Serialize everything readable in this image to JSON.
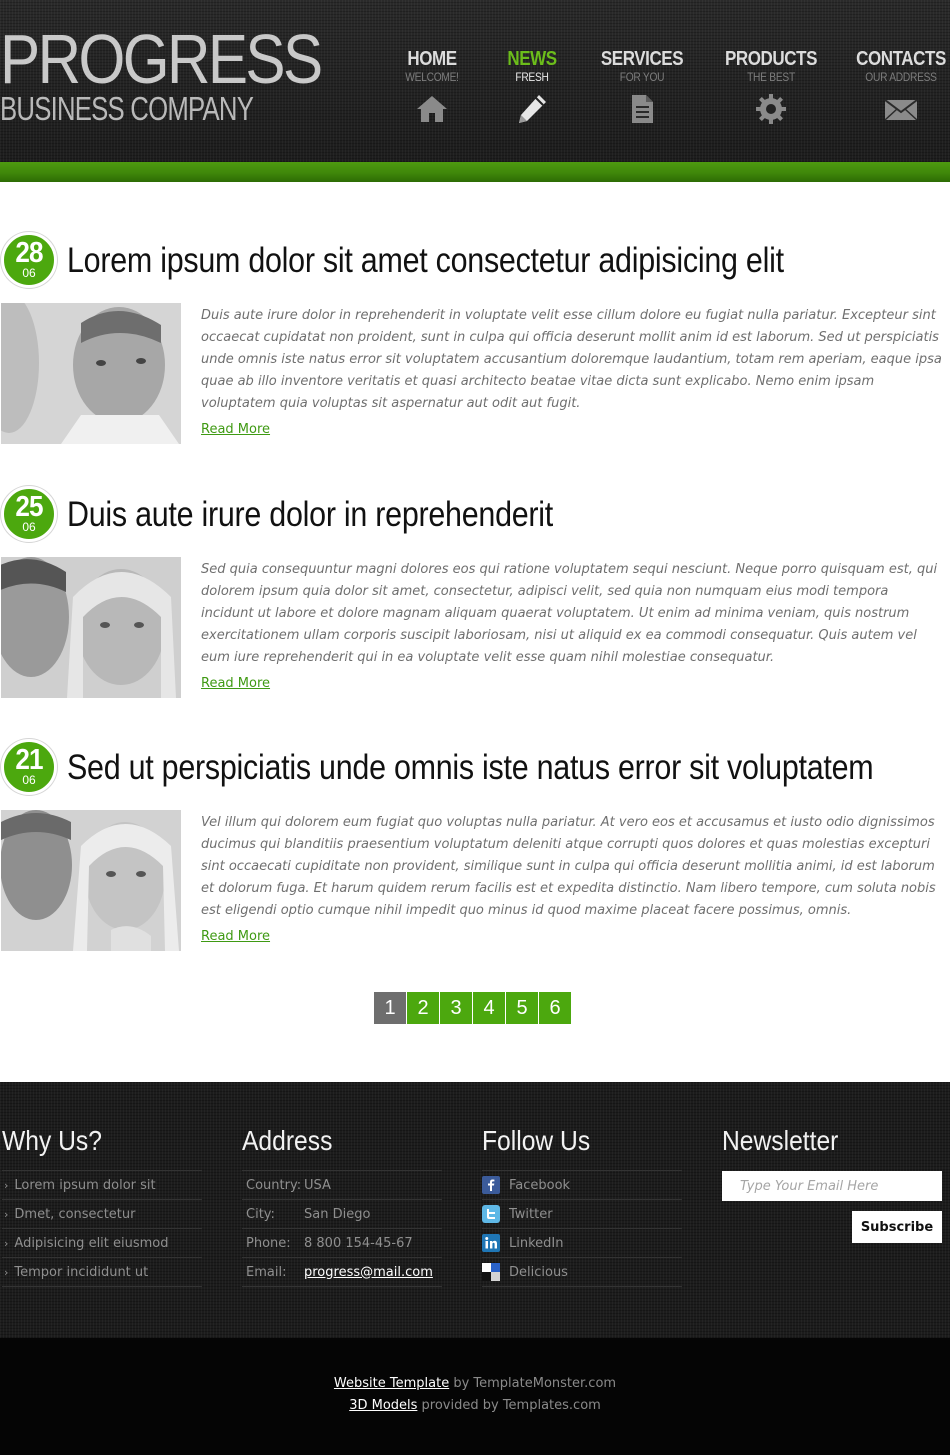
{
  "logo": {
    "main": "PROGRESS",
    "sub": "BUSINESS COMPANY"
  },
  "nav": [
    {
      "title": "HOME",
      "sub": "WELCOME!",
      "icon": "home-icon"
    },
    {
      "title": "NEWS",
      "sub": "FRESH",
      "icon": "pencil-icon",
      "active": true
    },
    {
      "title": "SERVICES",
      "sub": "FOR YOU",
      "icon": "document-icon"
    },
    {
      "title": "PRODUCTS",
      "sub": "THE BEST",
      "icon": "gear-icon"
    },
    {
      "title": "CONTACTS",
      "sub": "OUR ADDRESS",
      "icon": "envelope-icon"
    }
  ],
  "colors": {
    "accent": "#4ca80e",
    "link": "#3f9a13",
    "header_bg": "#222222",
    "footer_bg": "#1c1c1c"
  },
  "posts": [
    {
      "day": "28",
      "month": "06",
      "title": "Lorem ipsum dolor sit amet consectetur adipisicing elit",
      "text": "Duis aute irure dolor in reprehenderit in voluptate velit esse cillum dolore eu fugiat nulla pariatur. Excepteur sint occaecat cupidatat non proident, sunt in culpa qui officia deserunt mollit anim id est laborum. Sed ut perspiciatis unde omnis iste natus error sit voluptatem accusantium doloremque laudantium, totam rem aperiam, eaque ipsa quae ab illo inventore veritatis et quasi architecto beatae vitae dicta sunt explicabo. Nemo enim ipsam voluptatem quia voluptas sit aspernatur aut odit aut fugit.",
      "read_more": "Read More"
    },
    {
      "day": "25",
      "month": "06",
      "title": "Duis aute irure dolor in reprehenderit",
      "text": "Sed quia consequuntur magni dolores eos qui ratione voluptatem sequi nesciunt. Neque porro quisquam est, qui dolorem ipsum quia dolor sit amet, consectetur, adipisci velit, sed quia non numquam eius modi tempora incidunt ut labore et dolore magnam aliquam quaerat voluptatem. Ut enim ad minima veniam, quis nostrum exercitationem ullam corporis suscipit laboriosam, nisi ut aliquid ex ea commodi consequatur. Quis autem vel eum iure reprehenderit qui in ea voluptate velit esse quam nihil molestiae consequatur.",
      "read_more": "Read More"
    },
    {
      "day": "21",
      "month": "06",
      "title": "Sed ut perspiciatis unde omnis iste natus error sit voluptatem",
      "text": "Vel illum qui dolorem eum fugiat quo voluptas nulla pariatur. At vero eos et accusamus et iusto odio dignissimos ducimus qui blanditiis praesentium voluptatum deleniti atque corrupti quos dolores et quas molestias excepturi sint occaecati cupiditate non provident, similique sunt in culpa qui officia deserunt mollitia animi, id est laborum et dolorum fuga. Et harum quidem rerum facilis est et expedita distinctio. Nam libero tempore, cum soluta nobis est eligendi optio cumque nihil impedit quo minus id quod maxime placeat facere possimus, omnis.",
      "read_more": "Read More"
    }
  ],
  "pagination": {
    "pages": [
      "1",
      "2",
      "3",
      "4",
      "5",
      "6"
    ],
    "current": "1"
  },
  "footer": {
    "why_us": {
      "title": "Why Us?",
      "items": [
        "Lorem ipsum dolor sit",
        "Dmet, consectetur",
        "Adipisicing elit eiusmod",
        "Tempor incididunt ut"
      ]
    },
    "address": {
      "title": "Address",
      "rows": [
        {
          "key": "Country:",
          "value": "USA"
        },
        {
          "key": "City:",
          "value": "San Diego"
        },
        {
          "key": "Phone:",
          "value": "8 800 154-45-67"
        },
        {
          "key": "Email:",
          "value": "progress@mail.com"
        }
      ]
    },
    "follow": {
      "title": "Follow Us",
      "items": [
        {
          "label": "Facebook",
          "icon": "facebook-icon"
        },
        {
          "label": "Twitter",
          "icon": "twitter-icon"
        },
        {
          "label": "LinkedIn",
          "icon": "linkedin-icon"
        },
        {
          "label": "Delicious",
          "icon": "delicious-icon"
        }
      ]
    },
    "newsletter": {
      "title": "Newsletter",
      "placeholder": "Type Your Email Here",
      "button": "Subscribe"
    }
  },
  "credits": {
    "line1_link": "Website Template",
    "line1_text": " by TemplateMonster.com",
    "line2_link": "3D Models",
    "line2_text": " provided by Templates.com"
  }
}
